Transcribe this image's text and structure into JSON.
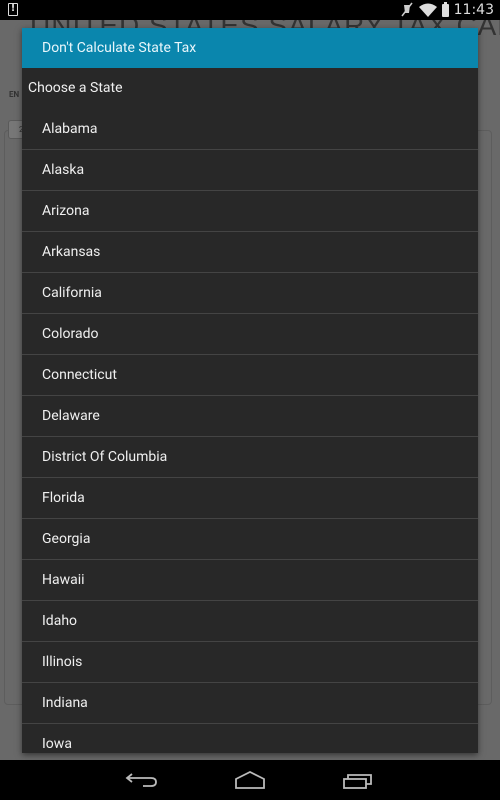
{
  "status_bar": {
    "time": "11:43",
    "notification_icon": "alert-icon",
    "icons": [
      "mute-icon",
      "wifi-icon",
      "battery-icon"
    ]
  },
  "background": {
    "title": "UNITED STATES SALARY TAX CALCULATOR FOR",
    "label": "EN",
    "input_value": "2"
  },
  "dialog": {
    "header": "Don't Calculate State Tax",
    "section_label": "Choose a State",
    "states": [
      "Alabama",
      "Alaska",
      "Arizona",
      "Arkansas",
      "California",
      "Colorado",
      "Connecticut",
      "Delaware",
      "District Of Columbia",
      "Florida",
      "Georgia",
      "Hawaii",
      "Idaho",
      "Illinois",
      "Indiana",
      "Iowa"
    ]
  },
  "nav_bar": {
    "buttons": [
      "back",
      "home",
      "recent-apps"
    ]
  },
  "colors": {
    "accent": "#0a86ad",
    "dialog_bg": "#282828",
    "divider": "#444444"
  }
}
